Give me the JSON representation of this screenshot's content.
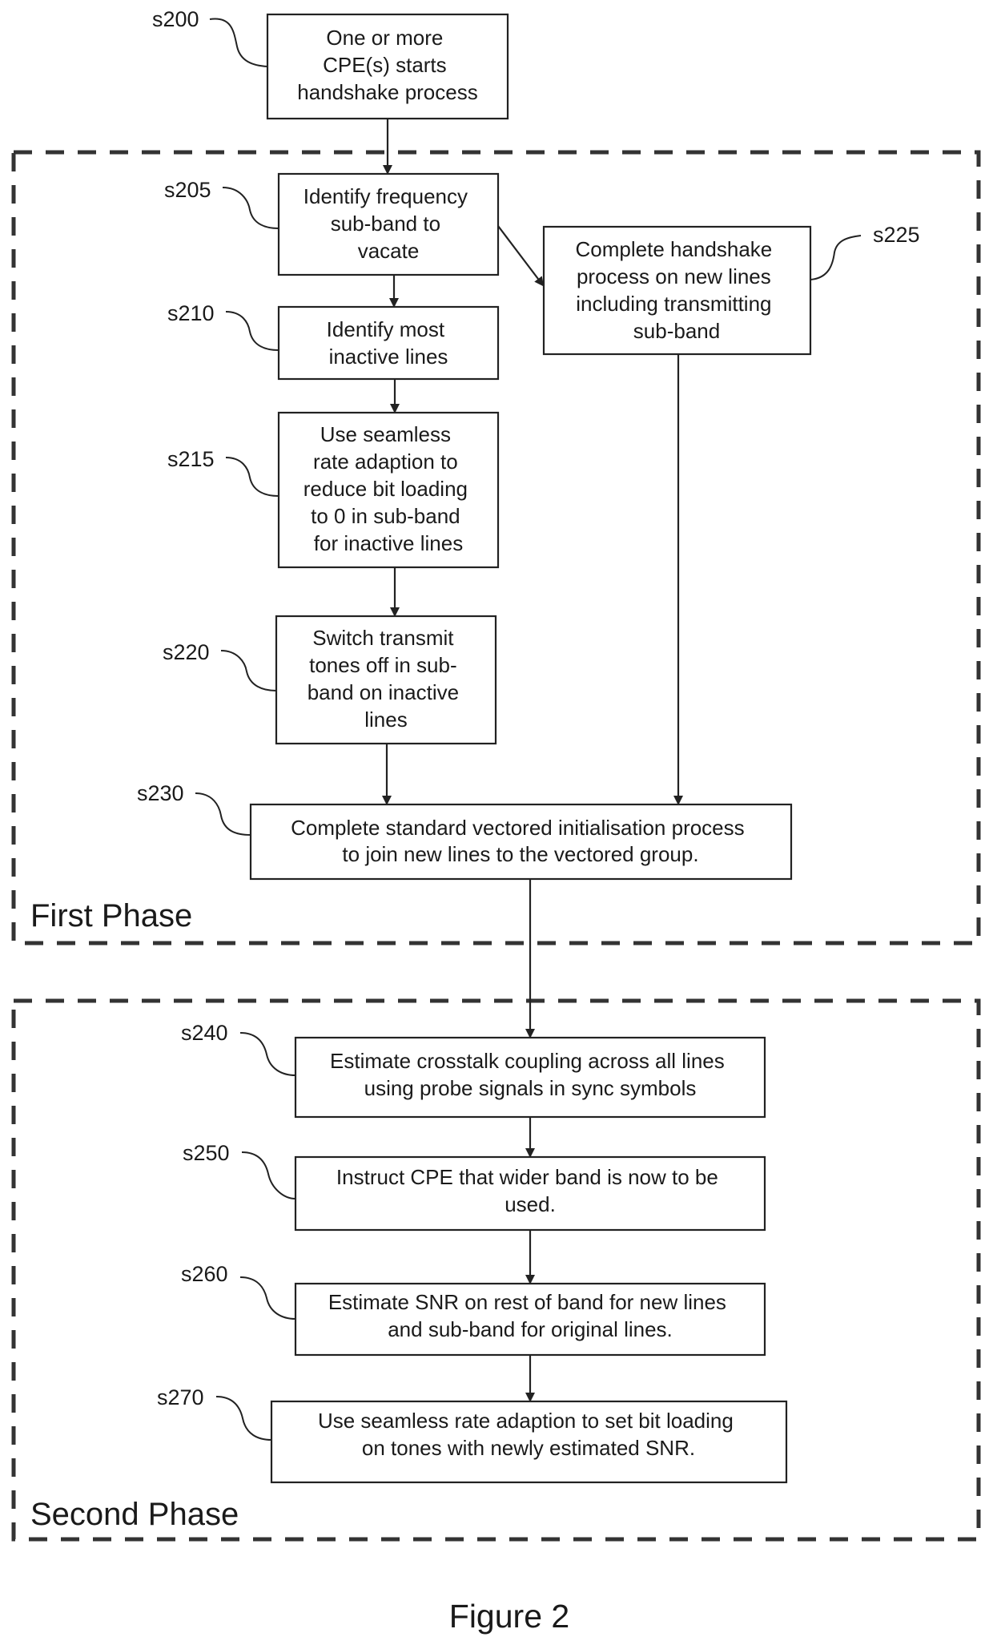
{
  "figure": {
    "caption": "Figure 2"
  },
  "phases": [
    {
      "id": "first",
      "label": "First Phase"
    },
    {
      "id": "second",
      "label": "Second Phase"
    }
  ],
  "steps": [
    {
      "id": "s200",
      "label": "s200",
      "lines": [
        "One or more",
        "CPE(s) starts",
        "handshake process"
      ]
    },
    {
      "id": "s205",
      "label": "s205",
      "lines": [
        "Identify frequency",
        "sub-band to",
        "vacate"
      ]
    },
    {
      "id": "s210",
      "label": "s210",
      "lines": [
        "Identify most",
        "inactive lines"
      ]
    },
    {
      "id": "s215",
      "label": "s215",
      "lines": [
        "Use seamless",
        "rate adaption to",
        "reduce bit loading",
        "to 0 in sub-band",
        "for inactive lines"
      ]
    },
    {
      "id": "s220",
      "label": "s220",
      "lines": [
        "Switch transmit",
        "tones off in sub-",
        "band on inactive",
        "lines"
      ]
    },
    {
      "id": "s225",
      "label": "s225",
      "lines": [
        "Complete handshake",
        "process on new lines",
        "including transmitting",
        "sub-band"
      ]
    },
    {
      "id": "s230",
      "label": "s230",
      "lines": [
        "Complete standard vectored initialisation process",
        "to join new lines to the vectored group."
      ]
    },
    {
      "id": "s240",
      "label": "s240",
      "lines": [
        "Estimate crosstalk coupling across all lines",
        "using probe signals in sync symbols"
      ]
    },
    {
      "id": "s250",
      "label": "s250",
      "lines": [
        "Instruct CPE that wider band is now to be",
        "used."
      ]
    },
    {
      "id": "s260",
      "label": "s260",
      "lines": [
        "Estimate SNR on rest of band for new lines",
        "and sub-band for original lines."
      ]
    },
    {
      "id": "s270",
      "label": "s270",
      "lines": [
        "Use seamless rate adaption to set bit loading",
        "on tones with newly estimated SNR."
      ]
    }
  ],
  "edges": [
    {
      "from": "s200",
      "to": "s205"
    },
    {
      "from": "s205",
      "to": "s210"
    },
    {
      "from": "s205",
      "to": "s225"
    },
    {
      "from": "s210",
      "to": "s215"
    },
    {
      "from": "s215",
      "to": "s220"
    },
    {
      "from": "s220",
      "to": "s230"
    },
    {
      "from": "s225",
      "to": "s230"
    },
    {
      "from": "s230",
      "to": "s240"
    },
    {
      "from": "s240",
      "to": "s250"
    },
    {
      "from": "s250",
      "to": "s260"
    },
    {
      "from": "s260",
      "to": "s270"
    }
  ]
}
